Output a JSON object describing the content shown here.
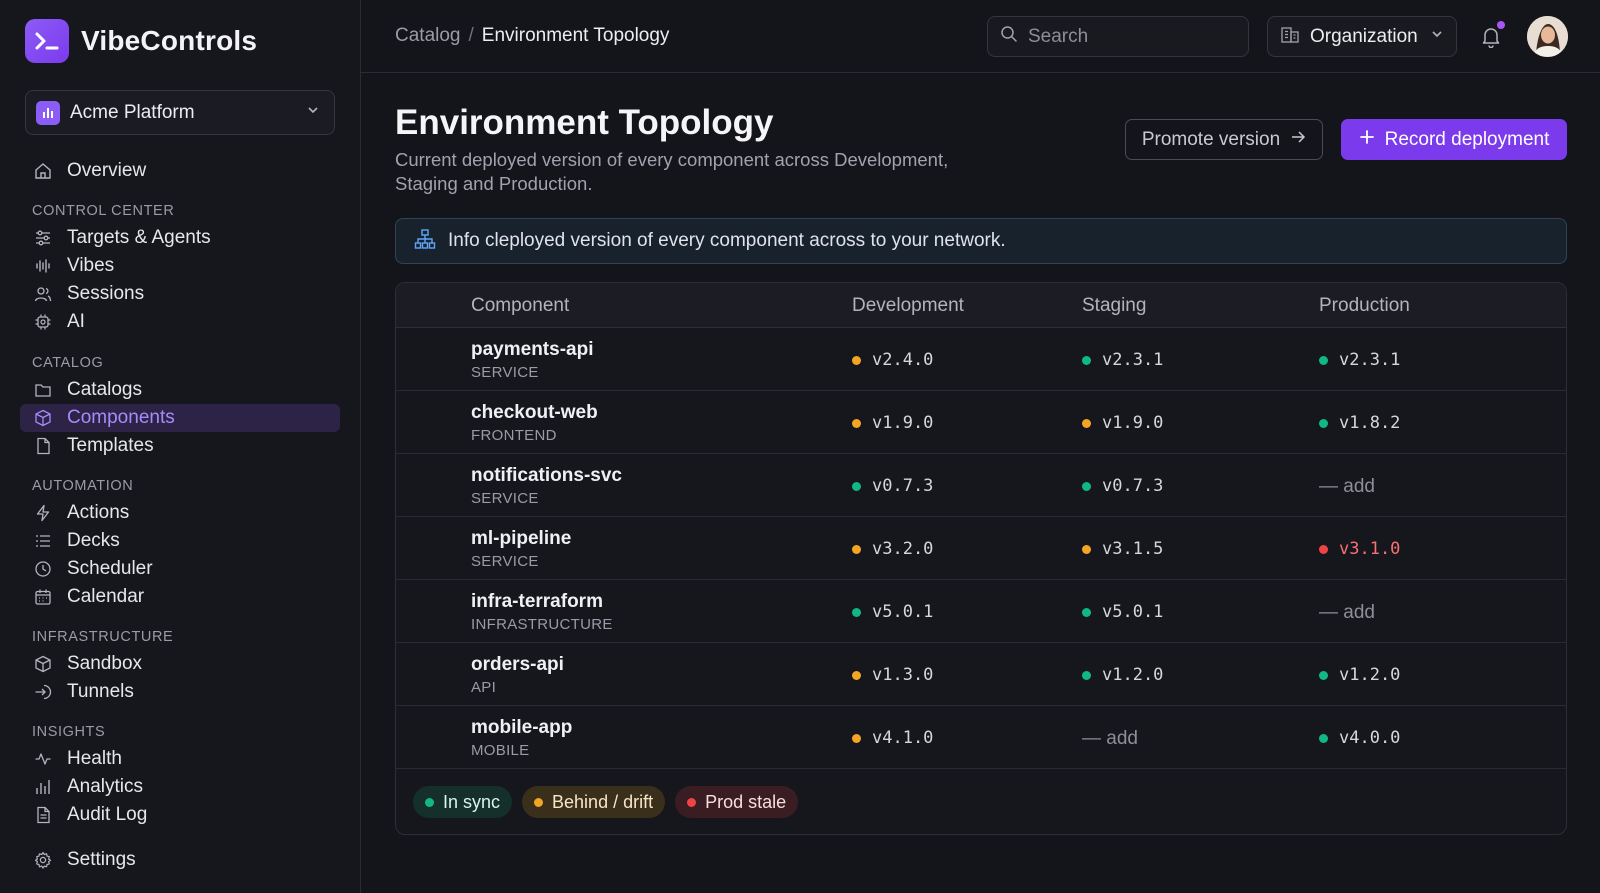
{
  "brand": {
    "name": "VibeControls"
  },
  "org_select": {
    "label": "Acme Platform"
  },
  "nav": {
    "overview": "Overview",
    "sections": {
      "control_center": "CONTROL CENTER",
      "catalog": "CATALOG",
      "automation": "AUTOMATION",
      "infrastructure": "INFRASTRUCTURE",
      "insights": "INSIGHTS"
    },
    "items": {
      "targets_agents": "Targets & Agents",
      "vibes": "Vibes",
      "sessions": "Sessions",
      "ai": "AI",
      "catalogs": "Catalogs",
      "components": "Components",
      "templates": "Templates",
      "actions": "Actions",
      "decks": "Decks",
      "scheduler": "Scheduler",
      "calendar": "Calendar",
      "sandbox": "Sandbox",
      "tunnels": "Tunnels",
      "health": "Health",
      "analytics": "Analytics",
      "audit_log": "Audit Log"
    },
    "settings": "Settings"
  },
  "topbar": {
    "breadcrumb": {
      "root": "Catalog",
      "separator": "/",
      "current": "Environment Topology"
    },
    "search_placeholder": "Search",
    "org_switcher": "Organization"
  },
  "page": {
    "title": "Environment Topology",
    "subtitle": "Current deployed version of every component across Development, Staging and Production.",
    "promote_button": "Promote version",
    "record_button": "Record deployment",
    "info": "Info cleployed version of every component across to your network."
  },
  "table": {
    "headers": {
      "component": "Component",
      "development": "Development",
      "staging": "Staging",
      "production": "Production"
    },
    "rows": [
      {
        "name": "payments-api",
        "type": "SERVICE",
        "dev": "v2.4.0",
        "staging": "v2.3.1",
        "prod": "v2.3.1"
      },
      {
        "name": "checkout-web",
        "type": "FRONTEND",
        "dev": "v1.9.0",
        "staging": "v1.9.0",
        "prod": "v1.8.2"
      },
      {
        "name": "notifications-svc",
        "type": "SERVICE",
        "dev": "v0.7.3",
        "staging": "v0.7.3",
        "prod": "— add"
      },
      {
        "name": "ml-pipeline",
        "type": "SERVICE",
        "dev": "v3.2.0",
        "staging": "v3.1.5",
        "prod": "v3.1.0"
      },
      {
        "name": "infra-terraform",
        "type": "INFRASTRUCTURE",
        "dev": "v5.0.1",
        "staging": "v5.0.1",
        "prod": "— add"
      },
      {
        "name": "orders-api",
        "type": "API",
        "dev": "v1.3.0",
        "staging": "v1.2.0",
        "prod": "v1.2.0"
      },
      {
        "name": "mobile-app",
        "type": "MOBILE",
        "dev": "v4.1.0",
        "staging": "— add",
        "prod": "v4.0.0"
      }
    ]
  },
  "legend": {
    "in_sync": "In sync",
    "behind": "Behind / drift",
    "stale": "Prod stale"
  },
  "colors": {
    "accent": "#7c3aed",
    "sync": "#10b981",
    "drift": "#f5a524",
    "stale": "#ef4444"
  }
}
